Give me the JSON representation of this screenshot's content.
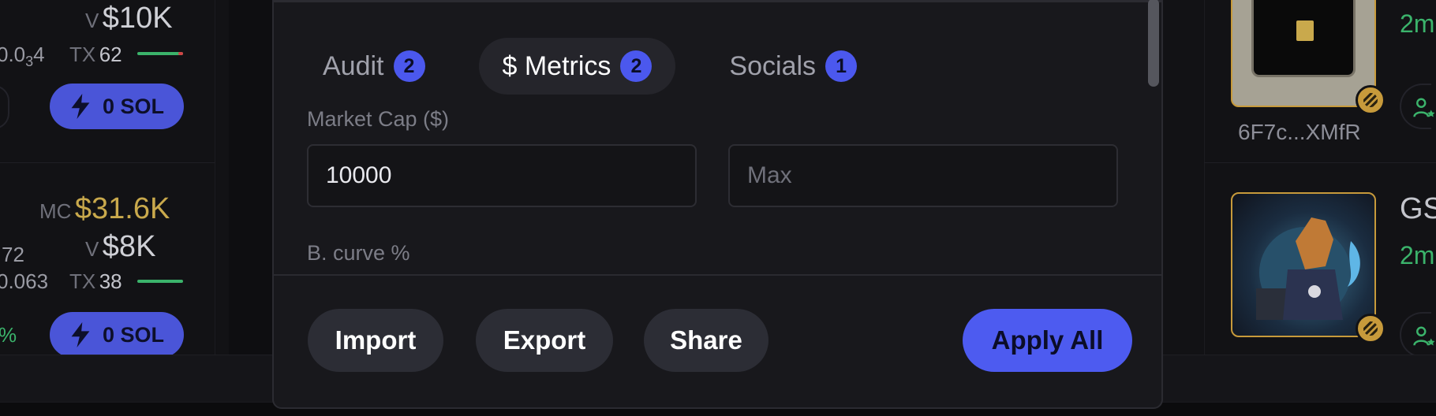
{
  "left_cards": [
    {
      "volume_label": "V",
      "volume_value": "$10K",
      "price_fragment": "0.0",
      "price_sub": "3",
      "price_tail": "4",
      "tx_label": "TX",
      "tx_count": "62",
      "buy_label": "0 SOL"
    },
    {
      "mc_label": "MC",
      "mc_value": "$31.6K",
      "volume_label": "V",
      "volume_value": "$8K",
      "left_fragment_1": "72",
      "left_fragment_2": "0.063",
      "tx_label": "TX",
      "tx_count": "38",
      "percent_fragment": "%",
      "buy_label": "0 SOL"
    }
  ],
  "modal": {
    "tabs": [
      {
        "label": "Audit",
        "count": "2",
        "active": false
      },
      {
        "label": "$ Metrics",
        "count": "2",
        "active": true
      },
      {
        "label": "Socials",
        "count": "1",
        "active": false
      }
    ],
    "market_cap_label": "Market Cap ($)",
    "market_cap_min_value": "10000",
    "market_cap_max_placeholder": "Max",
    "bonding_curve_label": "B. curve %",
    "buttons": {
      "import": "Import",
      "export": "Export",
      "share": "Share",
      "apply_all": "Apply All"
    }
  },
  "right_cards": [
    {
      "address": "6F7c...XMfR",
      "age_fragment": "2m"
    },
    {
      "name_fragment": "GS",
      "age_fragment": "2m"
    }
  ],
  "colors": {
    "accent": "#4d5bf0",
    "gold": "#c9a94c",
    "green": "#3bb36b",
    "modal_bg": "#18181c"
  }
}
